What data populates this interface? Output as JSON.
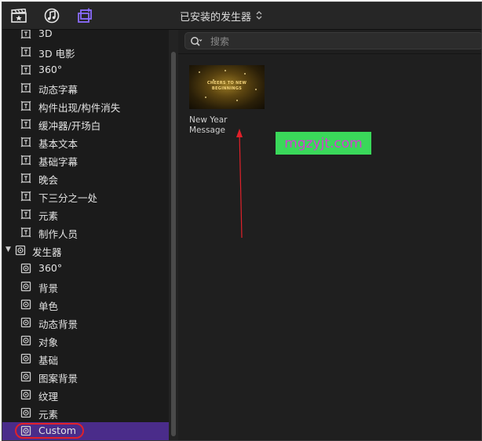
{
  "toolbar": {
    "icons": [
      "clapperboard-star-icon",
      "music-note-icon",
      "generator-icon"
    ],
    "library_title": "已安装的发生器",
    "active_color": "#8a6bff"
  },
  "sidebar": {
    "titles_items": [
      {
        "label": "3D",
        "icon": "title-icon"
      },
      {
        "label": "3D 电影",
        "icon": "title-icon"
      },
      {
        "label": "360°",
        "icon": "title-icon"
      },
      {
        "label": "动态字幕",
        "icon": "title-icon"
      },
      {
        "label": "构件出现/构件消失",
        "icon": "title-icon"
      },
      {
        "label": "缓冲器/开场白",
        "icon": "title-icon"
      },
      {
        "label": "基本文本",
        "icon": "title-icon"
      },
      {
        "label": "基础字幕",
        "icon": "title-icon"
      },
      {
        "label": "晚会",
        "icon": "title-icon"
      },
      {
        "label": "下三分之一处",
        "icon": "title-icon"
      },
      {
        "label": "元素",
        "icon": "title-icon"
      },
      {
        "label": "制作人员",
        "icon": "title-icon"
      }
    ],
    "generators_header": "发生器",
    "generator_items": [
      {
        "label": "360°",
        "icon": "generator-icon"
      },
      {
        "label": "背景",
        "icon": "generator-icon"
      },
      {
        "label": "单色",
        "icon": "generator-icon"
      },
      {
        "label": "动态背景",
        "icon": "generator-icon"
      },
      {
        "label": "对象",
        "icon": "generator-icon"
      },
      {
        "label": "基础",
        "icon": "generator-icon"
      },
      {
        "label": "图案背景",
        "icon": "generator-icon"
      },
      {
        "label": "纹理",
        "icon": "generator-icon"
      },
      {
        "label": "元素",
        "icon": "generator-icon"
      },
      {
        "label": "Custom",
        "icon": "generator-icon",
        "selected": true
      }
    ],
    "selected_color": "#4a2c8a"
  },
  "browser": {
    "search_placeholder": "搜索",
    "tiles": [
      {
        "name": "New Year Message",
        "thumb_text": [
          "CHEERS TO NEW",
          "BEGINNINGS"
        ]
      }
    ]
  },
  "watermark": "mgzyjt.com",
  "annotation_color": "#e0202a"
}
